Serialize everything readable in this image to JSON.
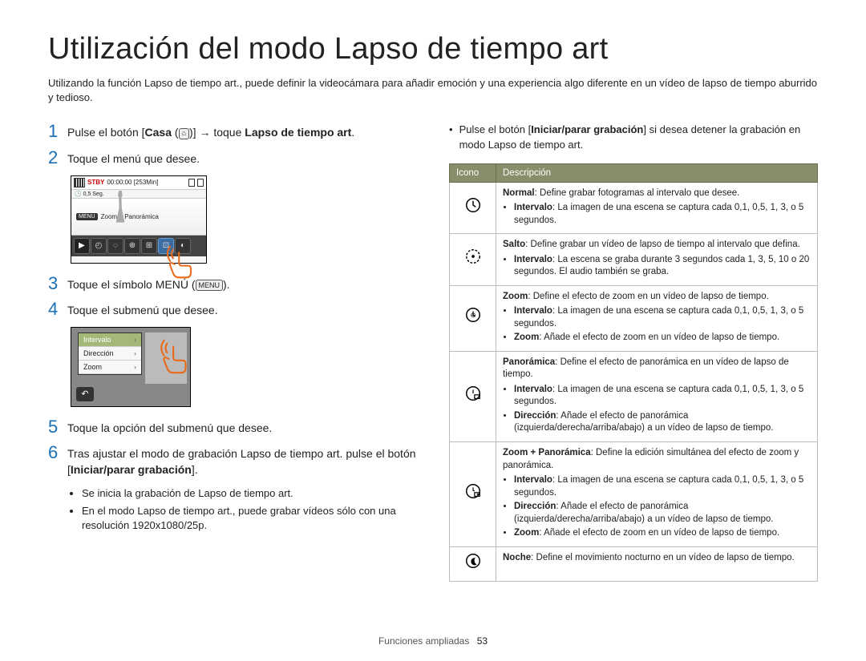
{
  "title": "Utilización del modo Lapso de tiempo art",
  "intro": "Utilizando la función Lapso de tiempo art., puede definir la videocámara para añadir emoción y una experiencia algo diferente en un vídeo de lapso de tiempo aburrido y tedioso.",
  "steps": {
    "s1_a": "Pulse el botón [",
    "s1_b": "Casa",
    "s1_c": " (",
    "s1_d": ")] ",
    "s1_arrow": "→",
    "s1_e": " toque ",
    "s1_f": "Lapso de tiempo art",
    "s1_g": ".",
    "s2": "Toque el menú que desee.",
    "s3_a": "Toque el símbolo MENÚ (",
    "s3_b": ").",
    "s4": "Toque el submenú que desee.",
    "s5": "Toque la opción del submenú que desee.",
    "s6_a": "Tras ajustar el modo de grabación Lapso de tiempo art. pulse el botón [",
    "s6_b": "Iniciar/parar grabación",
    "s6_c": "]."
  },
  "bullets_left": [
    "Se inicia la grabación de Lapso de tiempo art.",
    "En el modo Lapso de tiempo art., puede grabar vídeos sólo con una resolución 1920x1080/25p."
  ],
  "shot1": {
    "stby": "STBY",
    "time": "00:00:00 [253Min]",
    "sec": "0,5 Seg.",
    "menu": "MENU",
    "label": "Zoom + Panorámica"
  },
  "shot2": {
    "items": [
      "Intervalo",
      "Dirección",
      "Zoom"
    ]
  },
  "right_bullet_a": "Pulse el botón [",
  "right_bullet_b": "Iniciar/parar grabación",
  "right_bullet_c": "] si desea detener la grabación en modo Lapso de tiempo art.",
  "table": {
    "h1": "Icono",
    "h2": "Descripción",
    "rows": [
      {
        "title_bold": "Normal",
        "title_rest": ": Define grabar fotogramas al intervalo que desee.",
        "sub": [
          {
            "b": "Intervalo",
            "t": ": La imagen de una escena se captura cada 0,1, 0,5, 1, 3, o 5 segundos."
          }
        ]
      },
      {
        "title_bold": "Salto",
        "title_rest": ": Define grabar un vídeo de lapso de tiempo al intervalo que defina.",
        "sub": [
          {
            "b": "Intervalo",
            "t": ": La escena se graba durante 3 segundos cada 1, 3, 5, 10 o 20 segundos. El audio también se graba."
          }
        ]
      },
      {
        "title_bold": "Zoom",
        "title_rest": ": Define el efecto de zoom en un vídeo de lapso de tiempo.",
        "sub": [
          {
            "b": "Intervalo",
            "t": ": La imagen de una escena se captura cada 0,1, 0,5, 1, 3, o 5 segundos."
          },
          {
            "b": "Zoom",
            "t": ": Añade el efecto de zoom en un vídeo de lapso de tiempo."
          }
        ]
      },
      {
        "title_bold": "Panorámica",
        "title_rest": ": Define el efecto de panorámica en un vídeo de lapso de tiempo.",
        "sub": [
          {
            "b": "Intervalo",
            "t": ": La imagen de una escena se captura cada 0,1, 0,5, 1, 3, o 5 segundos."
          },
          {
            "b": "Dirección",
            "t": ": Añade el efecto de panorámica (izquierda/derecha/arriba/abajo) a un vídeo de lapso de tiempo."
          }
        ]
      },
      {
        "title_bold": "Zoom + Panorámica",
        "title_rest": ": Define la edición simultánea del efecto de zoom y panorámica.",
        "sub": [
          {
            "b": "Intervalo",
            "t": ": La imagen de una escena se captura cada 0,1, 0,5, 1, 3, o 5 segundos."
          },
          {
            "b": "Dirección",
            "t": ": Añade el efecto de panorámica (izquierda/derecha/arriba/abajo) a un vídeo de lapso de tiempo."
          },
          {
            "b": "Zoom",
            "t": ": Añade el efecto de zoom en un vídeo de lapso de tiempo."
          }
        ]
      },
      {
        "title_bold": "Noche",
        "title_rest": ": Define el movimiento nocturno en un vídeo de lapso de tiempo.",
        "sub": []
      }
    ]
  },
  "footer_label": "Funciones ampliadas",
  "footer_page": "53",
  "menu_glyph": "MENU",
  "home_glyph": "⌂"
}
